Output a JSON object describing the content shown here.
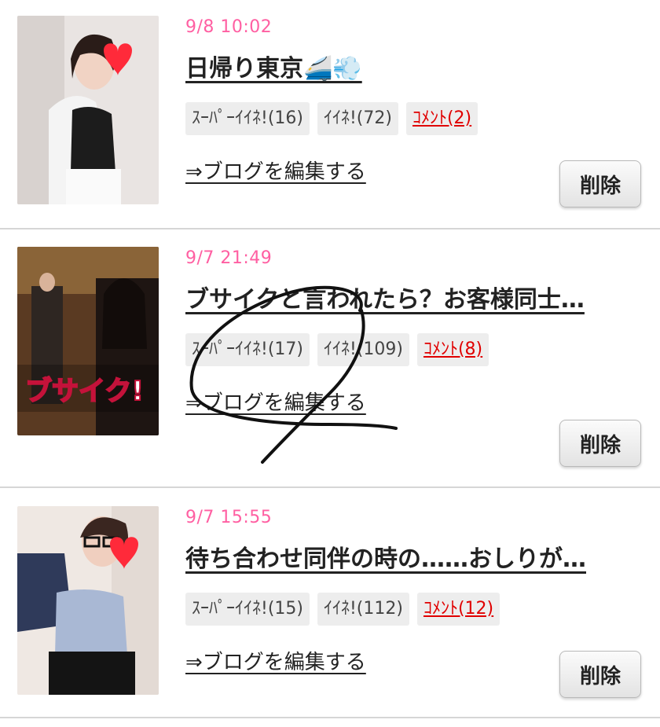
{
  "entries": [
    {
      "date": "9/8 10:02",
      "title": "日帰り東京🚄💨",
      "badges": {
        "super_like": "ｽｰﾊﾟｰｲｲﾈ!(16)",
        "like": "ｲｲﾈ!(72)",
        "comment": "ｺﾒﾝﾄ(2)"
      },
      "edit_link": "⇒ブログを編集する",
      "delete_label": "削除"
    },
    {
      "date": "9/7 21:49",
      "title": "ブサイクと言われたら？お客様同士…",
      "badges": {
        "super_like": "ｽｰﾊﾟｰｲｲﾈ!(17)",
        "like": "ｲｲﾈ!(109)",
        "comment": "ｺﾒﾝﾄ(8)"
      },
      "edit_link": "⇒ブログを編集する",
      "delete_label": "削除",
      "thumb_overlay_text": "ブサイク!"
    },
    {
      "date": "9/7 15:55",
      "title": "待ち合わせ同伴の時の……おしりが…",
      "badges": {
        "super_like": "ｽｰﾊﾟｰｲｲﾈ!(15)",
        "like": "ｲｲﾈ!(112)",
        "comment": "ｺﾒﾝﾄ(12)"
      },
      "edit_link": "⇒ブログを編集する",
      "delete_label": "削除"
    }
  ],
  "colors": {
    "date": "#ff5fa2",
    "comment": "#e00000",
    "heart": "#ff2a3a"
  },
  "icons": [
    "heart-sticker-icon"
  ]
}
